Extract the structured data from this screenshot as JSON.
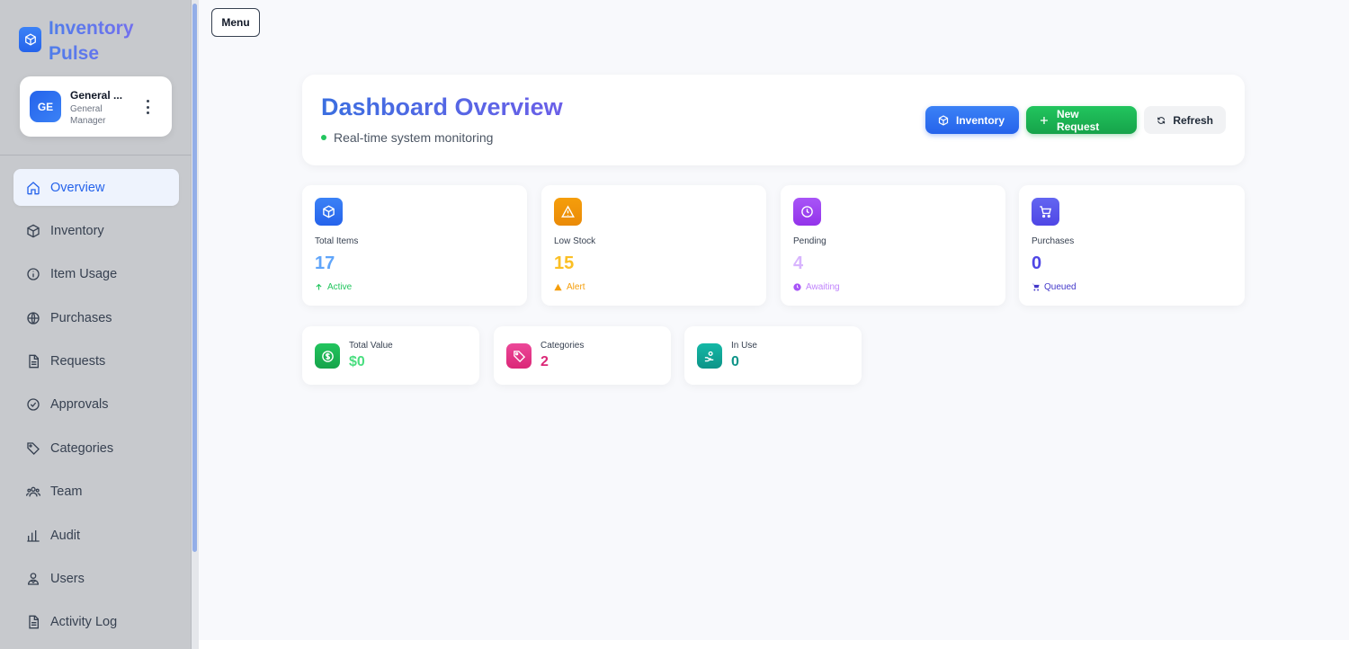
{
  "brand": {
    "name": "Inventory Pulse",
    "icon": "cube-icon"
  },
  "user": {
    "initials": "GE",
    "name": "General ...",
    "role": "General Manager"
  },
  "nav": [
    {
      "label": "Overview",
      "icon": "home-icon",
      "active": true
    },
    {
      "label": "Inventory",
      "icon": "cube-icon"
    },
    {
      "label": "Item Usage",
      "icon": "info-icon"
    },
    {
      "label": "Purchases",
      "icon": "globe-icon"
    },
    {
      "label": "Requests",
      "icon": "document-icon"
    },
    {
      "label": "Approvals",
      "icon": "check-circle-icon"
    },
    {
      "label": "Categories",
      "icon": "tag-icon"
    },
    {
      "label": "Team",
      "icon": "team-icon"
    },
    {
      "label": "Audit",
      "icon": "bar-chart-icon"
    },
    {
      "label": "Users",
      "icon": "users-icon"
    },
    {
      "label": "Activity Log",
      "icon": "document-icon"
    }
  ],
  "menu_button": "Menu",
  "header": {
    "title": "Dashboard Overview",
    "subtitle": "Real-time system monitoring",
    "actions": {
      "inventory": "Inventory",
      "new_request": "New Request",
      "refresh": "Refresh"
    }
  },
  "stats": [
    {
      "label": "Total Items",
      "value": "17",
      "footer": "Active",
      "icon": "cube-icon",
      "color": "#3b82f6",
      "value_color": "#60a5fa",
      "footer_color": "#22c55e"
    },
    {
      "label": "Low Stock",
      "value": "15",
      "footer": "Alert",
      "icon": "warning-icon",
      "color": "#f59e0b",
      "value_color": "#fbbf24",
      "footer_color": "#f59e0b"
    },
    {
      "label": "Pending",
      "value": "4",
      "footer": "Awaiting",
      "icon": "clock-icon",
      "color": "#a855f7",
      "value_color": "#d8b4fe",
      "footer_color": "#c084fc"
    },
    {
      "label": "Purchases",
      "value": "0",
      "footer": "Queued",
      "icon": "cart-icon",
      "color": "#6366f1",
      "value_color": "#4f46e5",
      "footer_color": "#4338ca"
    }
  ],
  "mini_stats": [
    {
      "label": "Total Value",
      "value": "$0",
      "icon": "dollar-icon",
      "color": "#22c55e",
      "value_color": "#4ade80"
    },
    {
      "label": "Categories",
      "value": "2",
      "icon": "tag-icon",
      "color": "#ec4899",
      "value_color": "#db2777"
    },
    {
      "label": "In Use",
      "value": "0",
      "icon": "user-hand-icon",
      "color": "#14b8a6",
      "value_color": "#0d9488"
    }
  ]
}
